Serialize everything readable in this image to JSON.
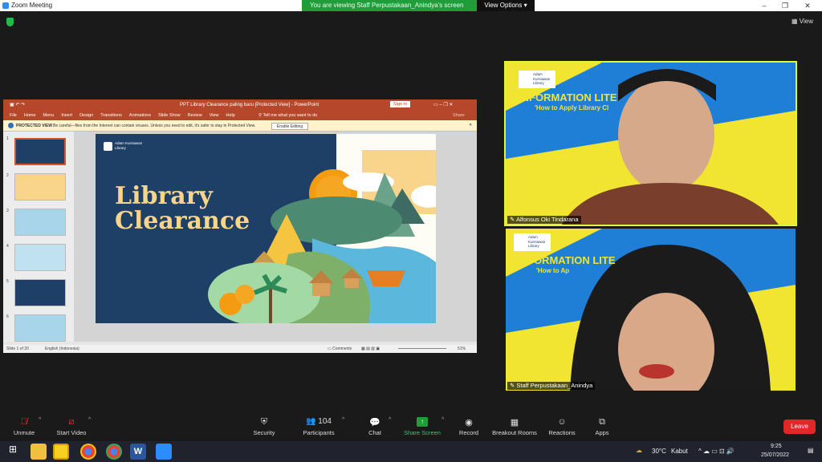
{
  "window": {
    "title": "Zoom Meeting"
  },
  "banner": {
    "message": "You are viewing Staff Perpustakaan_Anindya's screen",
    "view_options": "View Options"
  },
  "view_button": "View",
  "ppt": {
    "title": "PPT Library Clearance paling baru [Protected View] - PowerPoint",
    "sign_in": "Sign in",
    "tabs": [
      "File",
      "Home",
      "Menu",
      "Insert",
      "Design",
      "Transitions",
      "Animations",
      "Slide Show",
      "Review",
      "View",
      "Help"
    ],
    "tell_me": "Tell me what you want to do",
    "share": "Share",
    "protected_label": "PROTECTED VIEW",
    "protected_msg": "Be careful—files from the Internet can contain viruses. Unless you need to edit, it's safer to stay in Protected View.",
    "enable_editing": "Enable Editing",
    "slide_numbers": [
      "1",
      "2",
      "3",
      "4",
      "5",
      "6"
    ],
    "slide": {
      "logo": "Adam Kurniawan Library",
      "title_line1": "Library",
      "title_line2": "Clearance"
    },
    "status": {
      "slide_of": "Slide 1 of 20",
      "language": "English (Indonesia)",
      "comments": "Comments",
      "zoom": "51%"
    }
  },
  "participants_tiles": [
    {
      "name": "Alfonsus Oki Tindarana",
      "bg_title": "INFORMATION LITE",
      "bg_sub": "'How to Apply Library Cl",
      "logo": "Adam Kurniawan Library"
    },
    {
      "name": "Staff Perpustakaan_Anindya",
      "bg_title": "INFORMATION LITE",
      "bg_sub": "'How to Ap",
      "logo": "Adam Kurniawan Library"
    }
  ],
  "toolbar": {
    "unmute": "Unmute",
    "start_video": "Start Video",
    "security": "Security",
    "participants": "Participants",
    "participants_count": "104",
    "chat": "Chat",
    "share_screen": "Share Screen",
    "record": "Record",
    "breakout": "Breakout Rooms",
    "reactions": "Reactions",
    "apps": "Apps",
    "leave": "Leave"
  },
  "taskbar": {
    "weather_temp": "30°C",
    "weather_desc": "Kabut",
    "time": "9:25",
    "date": "25/07/2022"
  },
  "colors": {
    "zoom_blue": "#2d8cff",
    "share_green": "#1f9d3a",
    "leave_red": "#e02828",
    "ppt_red": "#b7472a",
    "slide_blue": "#1e3f66",
    "slide_title": "#f8d58a"
  }
}
